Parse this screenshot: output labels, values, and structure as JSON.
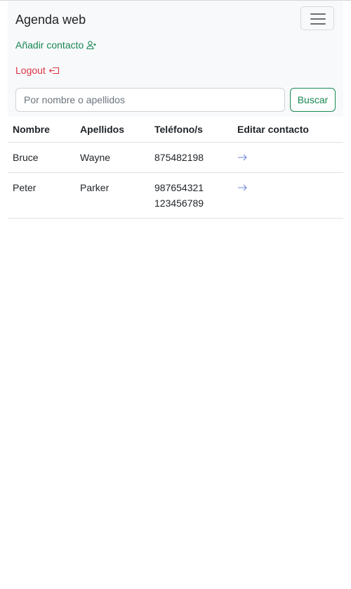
{
  "navbar": {
    "brand": "Agenda web",
    "toggler_icon": "menu-icon",
    "add_contact_label": "Añadir contacto",
    "add_contact_icon": "person-add-icon",
    "logout_label": "Logout",
    "logout_icon": "logout-icon"
  },
  "search": {
    "placeholder": "Por nombre o apellidos",
    "value": "",
    "button_label": "Buscar"
  },
  "table": {
    "headers": [
      "Nombre",
      "Apellidos",
      "Teléfono/s",
      "Editar contacto"
    ],
    "rows": [
      {
        "nombre": "Bruce",
        "apellidos": "Wayne",
        "telefonos": [
          "875482198"
        ],
        "edit_icon": "arrow-right-icon"
      },
      {
        "nombre": "Peter",
        "apellidos": "Parker",
        "telefonos": [
          "987654321",
          "123456789"
        ],
        "edit_icon": "arrow-right-icon"
      }
    ]
  },
  "colors": {
    "navbar_bg": "#f8f9fa",
    "success": "#198754",
    "danger": "#dc3545",
    "link": "#6f86d6"
  }
}
